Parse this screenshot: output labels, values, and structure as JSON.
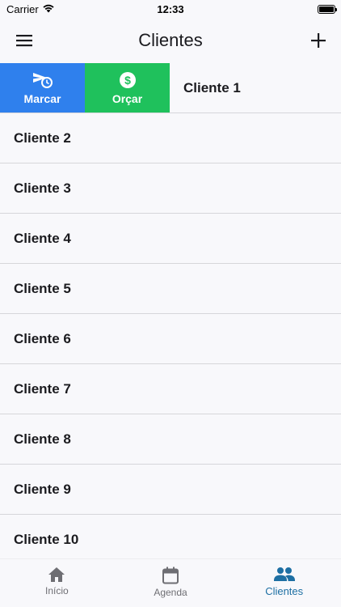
{
  "status": {
    "carrier": "Carrier",
    "time": "12:33"
  },
  "header": {
    "title": "Clientes"
  },
  "swipe_actions": {
    "marcar_label": "Marcar",
    "orcar_label": "Orçar"
  },
  "clients": [
    "Cliente 1",
    "Cliente 2",
    "Cliente 3",
    "Cliente 4",
    "Cliente 5",
    "Cliente 6",
    "Cliente 7",
    "Cliente 8",
    "Cliente 9",
    "Cliente 10"
  ],
  "tabs": [
    {
      "label": "Início",
      "icon": "home-icon"
    },
    {
      "label": "Agenda",
      "icon": "calendar-icon"
    },
    {
      "label": "Clientes",
      "icon": "people-icon"
    }
  ],
  "colors": {
    "accent": "#1d6fa3",
    "marcar": "#2f80ed",
    "orcar": "#1fc15c"
  }
}
